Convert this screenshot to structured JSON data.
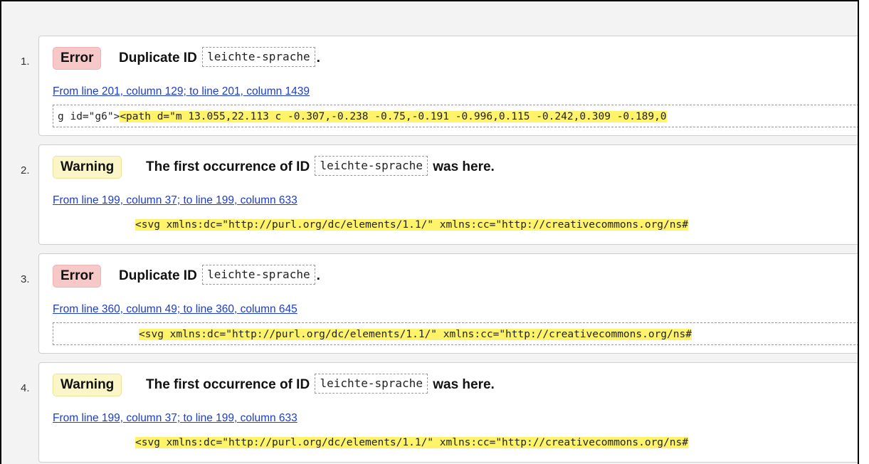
{
  "messages": [
    {
      "number": "1.",
      "type": "error",
      "badge": "Error",
      "title_pre": "Duplicate ID",
      "id_code": "leichte-sprache",
      "title_post": ".",
      "location": "From line 201, column 129; to line 201, column 1439",
      "extract_pre": "g id=\"g6\">",
      "extract_highlight": "<path d=\"m 13.055,22.113 c -0.307,-0.238 -0.75,-0.191 -0.996,0.115 -0.242,0.309 -0.189,0"
    },
    {
      "number": "2.",
      "type": "warning",
      "badge": "Warning",
      "title_pre": "The first occurrence of ID",
      "id_code": "leichte-sprache",
      "title_post": "was here.",
      "location": "From line 199, column 37; to line 199, column 633",
      "extract_pre": "",
      "extract_highlight": "<svg xmlns:dc=\"http://purl.org/dc/elements/1.1/\" xmlns:cc=\"http://creativecommons.org/ns#"
    },
    {
      "number": "3.",
      "type": "error",
      "badge": "Error",
      "title_pre": "Duplicate ID",
      "id_code": "leichte-sprache",
      "title_post": ".",
      "location": "From line 360, column 49; to line 360, column 645",
      "extract_pre": "",
      "extract_highlight": "<svg xmlns:dc=\"http://purl.org/dc/elements/1.1/\" xmlns:cc=\"http://creativecommons.org/ns#"
    },
    {
      "number": "4.",
      "type": "warning",
      "badge": "Warning",
      "title_pre": "The first occurrence of ID",
      "id_code": "leichte-sprache",
      "title_post": "was here.",
      "location": "From line 199, column 37; to line 199, column 633",
      "extract_pre": "",
      "extract_highlight": "<svg xmlns:dc=\"http://purl.org/dc/elements/1.1/\" xmlns:cc=\"http://creativecommons.org/ns#"
    }
  ]
}
